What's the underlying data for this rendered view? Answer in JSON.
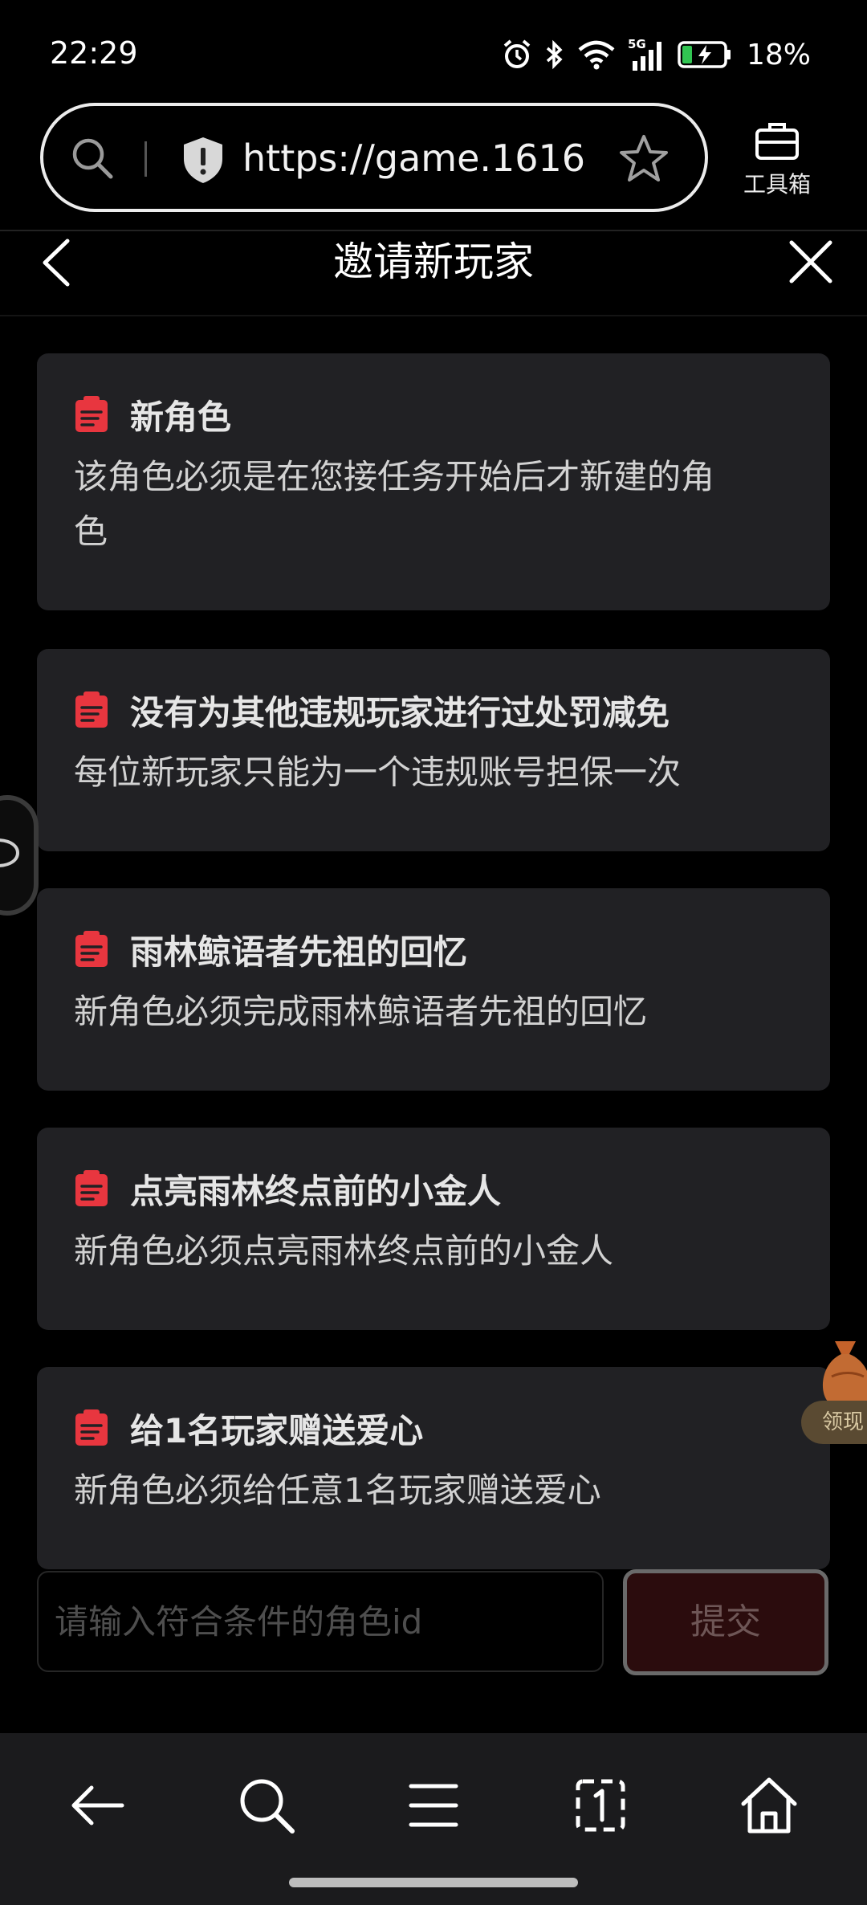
{
  "status_bar": {
    "time": "22:29",
    "network": "5G",
    "battery": "18%"
  },
  "browser": {
    "url": "https://game.1616...",
    "toolbox_label": "工具箱"
  },
  "header": {
    "title": "邀请新玩家"
  },
  "requirements": [
    {
      "title": "新角色",
      "desc_line1": "该角色必须是在您接任务开始后才新建的角",
      "desc_line2": "色"
    },
    {
      "title": "没有为其他违规玩家进行过处罚减免",
      "desc": "每位新玩家只能为一个违规账号担保一次"
    },
    {
      "title": "雨林鲸语者先祖的回忆",
      "desc": "新角色必须完成雨林鲸语者先祖的回忆"
    },
    {
      "title": "点亮雨林终点前的小金人",
      "desc": "新角色必须点亮雨林终点前的小金人"
    },
    {
      "title": "给1名玩家赠送爱心",
      "desc": "新角色必须给任意1名玩家赠送爱心"
    }
  ],
  "float_badge": {
    "label": "领现"
  },
  "form": {
    "placeholder": "请输入符合条件的角色id",
    "submit_label": "提交"
  },
  "colors": {
    "accent_red": "#e8363f",
    "card_bg": "#212124",
    "submit_bg": "#2b0c0d"
  },
  "icons": {
    "card": "clipboard-icon",
    "nav": [
      "back-arrow-icon",
      "search-icon",
      "menu-icon",
      "tabs-icon",
      "home-icon"
    ]
  }
}
